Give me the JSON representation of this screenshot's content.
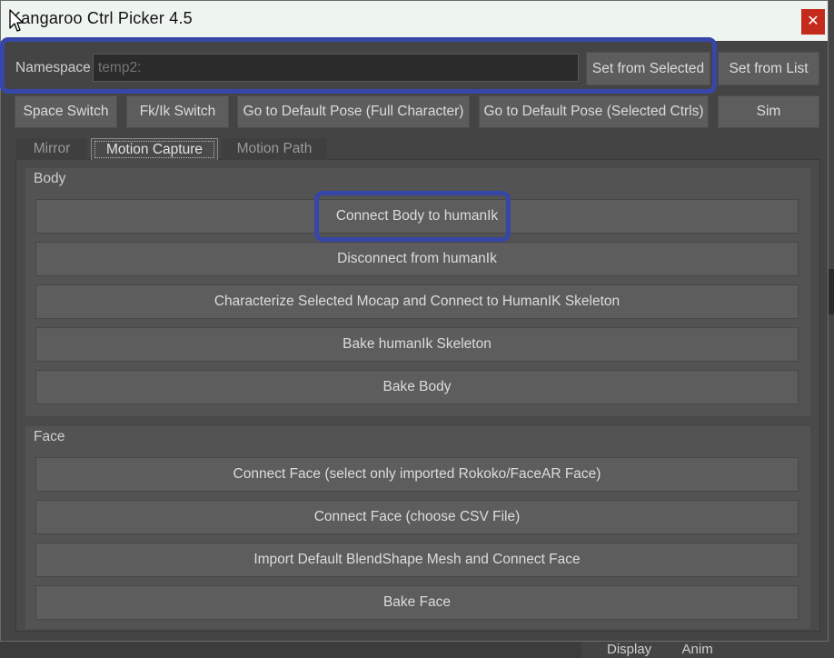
{
  "window": {
    "title": "Kangaroo Ctrl Picker 4.5",
    "close_label": "✕"
  },
  "namespace": {
    "label": "Namespace",
    "placeholder": "temp2:",
    "set_from_selected": "Set from Selected",
    "set_from_list": "Set from List"
  },
  "toolbar": {
    "space_switch": "Space Switch",
    "fkik_switch": "Fk/Ik Switch",
    "default_pose_full": "Go to Default Pose (Full Character)",
    "default_pose_selected": "Go to Default Pose (Selected Ctrls)",
    "sim": "Sim"
  },
  "tabs": [
    "Mirror",
    "Motion Capture",
    "Motion Path"
  ],
  "body_group": {
    "label": "Body",
    "buttons": [
      "Connect Body to humanIk",
      "Disconnect from humanIk",
      "Characterize Selected Mocap and Connect to HumanIK Skeleton",
      "Bake humanIk Skeleton",
      "Bake Body"
    ]
  },
  "face_group": {
    "label": "Face",
    "buttons": [
      "Connect Face (select only imported Rokoko/FaceAR Face)",
      "Connect Face (choose CSV File)",
      "Import Default BlendShape Mesh and Connect Face",
      "Bake Face"
    ]
  },
  "background_tabs": [
    "Display",
    "Anim"
  ],
  "colors": {
    "highlight": "#3747a8",
    "close": "#c42b1c",
    "titlebar": "#eef4ef"
  }
}
